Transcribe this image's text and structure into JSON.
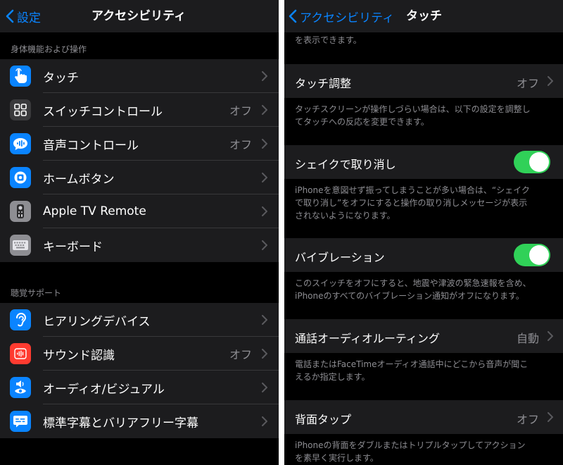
{
  "left": {
    "nav": {
      "back_label": "設定",
      "title": "アクセシビリティ"
    },
    "section1": {
      "header": "身体機能および操作",
      "items": [
        {
          "label": "タッチ",
          "value": "",
          "icon": "hand-point-icon",
          "color": "#0a84ff"
        },
        {
          "label": "スイッチコントロール",
          "value": "オフ",
          "icon": "grid-icon",
          "color": "#3a3a3c"
        },
        {
          "label": "音声コントロール",
          "value": "オフ",
          "icon": "voice-control-icon",
          "color": "#0a84ff"
        },
        {
          "label": "ホームボタン",
          "value": "",
          "icon": "home-button-icon",
          "color": "#0a84ff"
        },
        {
          "label": "Apple TV Remote",
          "value": "",
          "icon": "remote-icon",
          "color": "#8e8e93"
        },
        {
          "label": "キーボード",
          "value": "",
          "icon": "keyboard-icon",
          "color": "#8e8e93"
        }
      ]
    },
    "section2": {
      "header": "聴覚サポート",
      "items": [
        {
          "label": "ヒアリングデバイス",
          "value": "",
          "icon": "ear-icon",
          "color": "#0a84ff"
        },
        {
          "label": "サウンド認識",
          "value": "オフ",
          "icon": "waveform-icon",
          "color": "#ff3b30"
        },
        {
          "label": "オーディオ/ビジュアル",
          "value": "",
          "icon": "speaker-eye-icon",
          "color": "#0a84ff"
        },
        {
          "label": "標準字幕とバリアフリー字幕",
          "value": "",
          "icon": "caption-icon",
          "color": "#0a84ff"
        }
      ]
    }
  },
  "right": {
    "nav": {
      "back_label": "アクセシビリティ",
      "title": "タッチ"
    },
    "top_footer": "を表示できます。",
    "rows": [
      {
        "label": "タッチ調整",
        "value": "オフ",
        "kind": "chevron",
        "description": [
          "タッチスクリーンが操作しづらい場合は、以下の設定を調整し",
          "てタッチへの反応を変更できます。"
        ]
      },
      {
        "label": "シェイクで取り消し",
        "value": "",
        "kind": "toggle",
        "on": true,
        "description": [
          "iPhoneを意図せず振ってしまうことが多い場合は、“シェイク",
          "で取り消し”をオフにすると操作の取り消しメッセージが表示",
          "されないようになります。"
        ]
      },
      {
        "label": "バイブレーション",
        "value": "",
        "kind": "toggle",
        "on": true,
        "description": [
          "このスイッチをオフにすると、地震や津波の緊急速報を含め、",
          "iPhoneのすべてのバイブレーション通知がオフになります。"
        ]
      },
      {
        "label": "通話オーディオルーティング",
        "value": "自動",
        "kind": "chevron",
        "description": [
          "電話またはFaceTimeオーディオ通話中にどこから音声が聞こ",
          "えるか指定します。"
        ]
      },
      {
        "label": "背面タップ",
        "value": "オフ",
        "kind": "chevron",
        "description": [
          "iPhoneの背面をダブルまたはトリプルタップしてアクション",
          "を素早く実行します。"
        ]
      }
    ]
  },
  "colors": {
    "accent": "#0a84ff",
    "toggle_on": "#30d158"
  }
}
